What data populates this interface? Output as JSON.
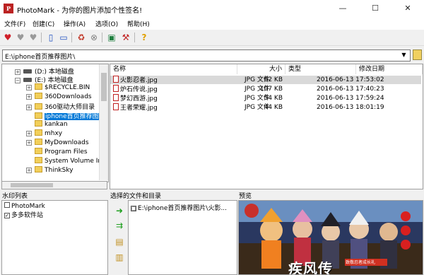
{
  "window": {
    "title": "PhotoMark - 为你的图片添加个性签名!",
    "app_icon_text": "P"
  },
  "menu": [
    "文件(F)",
    "创建(C)",
    "操作(A)",
    "选项(O)",
    "帮助(H)"
  ],
  "toolbar_icons": [
    "heart-icon",
    "heart-gray-icon",
    "heart-gray-icon",
    "new-file-icon",
    "open-file-icon",
    "recycle-icon",
    "stop-icon",
    "preview-icon",
    "tools-icon",
    "help-icon"
  ],
  "path": {
    "value": "E:\\iphone首页推荐图片\\"
  },
  "tree": [
    {
      "label": "(D:) 本地磁盘",
      "type": "drive",
      "expander": "+"
    },
    {
      "label": "(E:) 本地磁盘",
      "type": "drive",
      "expander": "−"
    },
    {
      "label": "$RECYCLE.BIN",
      "type": "folder",
      "expander": "+"
    },
    {
      "label": "360Downloads",
      "type": "folder",
      "expander": "+"
    },
    {
      "label": "360驱动大师目录",
      "type": "folder",
      "expander": "+"
    },
    {
      "label": "iphone首页推荐图",
      "type": "folder",
      "selected": true
    },
    {
      "label": "kankan",
      "type": "folder"
    },
    {
      "label": "mhxy",
      "type": "folder",
      "expander": "+"
    },
    {
      "label": "MyDownloads",
      "type": "folder",
      "expander": "+"
    },
    {
      "label": "Program Files",
      "type": "folder"
    },
    {
      "label": "System Volume In",
      "type": "folder"
    },
    {
      "label": "ThinkSky",
      "type": "folder",
      "expander": "+"
    }
  ],
  "file_columns": {
    "name": "名称",
    "size": "大小",
    "type": "类型",
    "modified": "修改日期"
  },
  "files": [
    {
      "name": "火影忍者.jpg",
      "size": "62 KB",
      "type": "JPG 文件",
      "modified": "2016-06-13 17:53:02",
      "selected": true
    },
    {
      "name": "炉石传说.jpg",
      "size": "107 KB",
      "type": "JPG 文件",
      "modified": "2016-06-13 17:40:23"
    },
    {
      "name": "梦幻西游.jpg",
      "size": "54 KB",
      "type": "JPG 文件",
      "modified": "2016-06-13 17:59:24"
    },
    {
      "name": "王者荣耀.jpg",
      "size": "44 KB",
      "type": "JPG 文件",
      "modified": "2016-06-13 18:01:19"
    }
  ],
  "panels": {
    "watermark_list": "水印列表",
    "selected_files": "选择的文件和目录",
    "preview": "预览"
  },
  "watermarks": [
    {
      "label": "PhotoMark",
      "checked": false
    },
    {
      "label": "多多软件站",
      "checked": true
    }
  ],
  "selected_entries": [
    "E:\\iphone首页推荐图片\\火影..."
  ],
  "preview": {
    "overlay_text": "疾风传",
    "banner_text": "致敬忍者成长礼"
  }
}
